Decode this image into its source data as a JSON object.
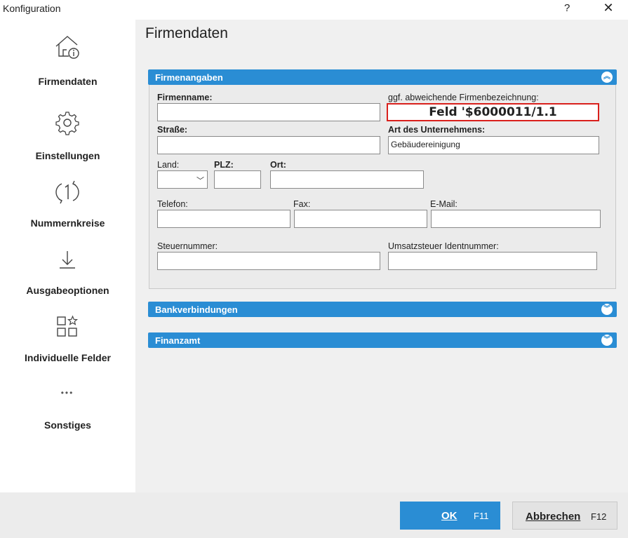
{
  "window": {
    "title": "Konfiguration",
    "help": "?",
    "close": "✕"
  },
  "sidebar": {
    "items": [
      {
        "label": "Firmendaten",
        "icon": "house-info-icon"
      },
      {
        "label": "Einstellungen",
        "icon": "gear-icon"
      },
      {
        "label": "Nummernkreise",
        "icon": "number-cycle-icon"
      },
      {
        "label": "Ausgabeoptionen",
        "icon": "download-icon"
      },
      {
        "label": "Individuelle Felder",
        "icon": "custom-fields-icon"
      },
      {
        "label": "Sonstiges",
        "icon": "more-icon"
      }
    ],
    "more_glyph": "•••"
  },
  "main": {
    "title": "Firmendaten",
    "sections": {
      "firmenangaben": {
        "title": "Firmenangaben",
        "chevron": "︽",
        "fields": {
          "firmenname": {
            "label": "Firmenname:",
            "value": ""
          },
          "abweichend": {
            "label": "ggf. abweichende Firmenbezeichnung:",
            "value": "Feld '$6000011/1.1"
          },
          "strasse": {
            "label": "Straße:",
            "value": ""
          },
          "art": {
            "label": "Art des Unternehmens:",
            "value": "Gebäudereinigung"
          },
          "land": {
            "label": "Land:",
            "value": ""
          },
          "plz": {
            "label": "PLZ:",
            "value": ""
          },
          "ort": {
            "label": "Ort:",
            "value": ""
          },
          "telefon": {
            "label": "Telefon:",
            "value": ""
          },
          "fax": {
            "label": "Fax:",
            "value": ""
          },
          "email": {
            "label": "E-Mail:",
            "value": ""
          },
          "steuernummer": {
            "label": "Steuernummer:",
            "value": ""
          },
          "ustid": {
            "label": "Umsatzsteuer Identnummer:",
            "value": ""
          }
        }
      },
      "bankverbindungen": {
        "title": "Bankverbindungen",
        "chevron": "︾"
      },
      "finanzamt": {
        "title": "Finanzamt",
        "chevron": "︾"
      }
    }
  },
  "footer": {
    "ok": {
      "label": "OK",
      "key": "F11"
    },
    "cancel": {
      "label": "Abbrechen",
      "key": "F12"
    }
  },
  "colors": {
    "accent": "#2a8dd4",
    "highlight_border": "#d9201c",
    "main_bg": "#f0f0f0"
  }
}
